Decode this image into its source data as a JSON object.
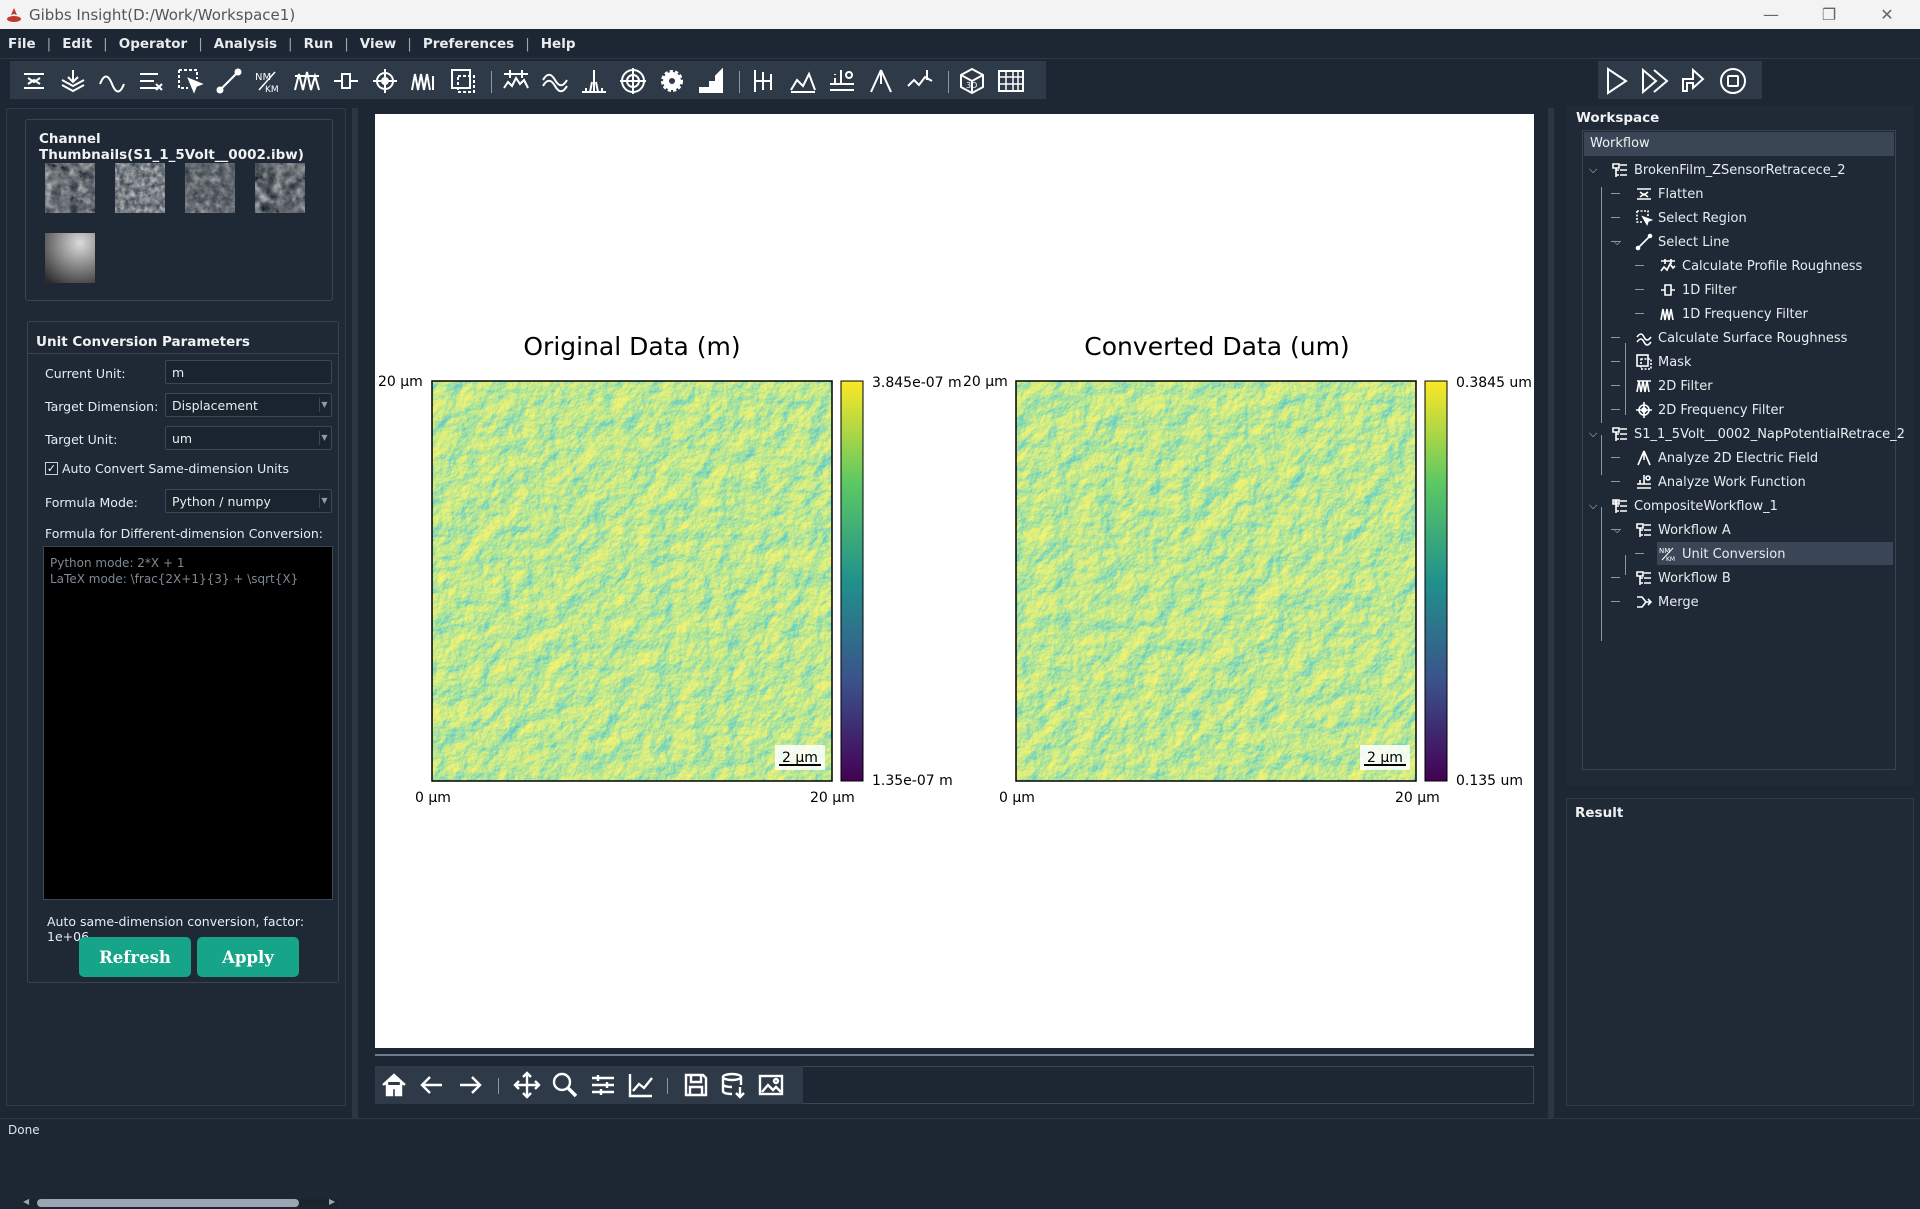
{
  "window": {
    "title": "Gibbs Insight(D:/Work/Workspace1)",
    "minimize": "—",
    "restore": "❐",
    "close": "✕"
  },
  "menu": [
    "File",
    "Edit",
    "Operator",
    "Analysis",
    "Run",
    "View",
    "Preferences",
    "Help"
  ],
  "menu_separator": "|",
  "left_panel": {
    "thumbnails_title": "Channel Thumbnails(S1_1_5Volt__0002.ibw)",
    "conversion": {
      "title": "Unit Conversion Parameters",
      "current_unit_label": "Current Unit:",
      "current_unit_value": "m",
      "target_dimension_label": "Target Dimension:",
      "target_dimension_value": "Displacement",
      "target_unit_label": "Target Unit:",
      "target_unit_value": "um",
      "auto_convert_label": "Auto Convert Same-dimension Units",
      "auto_convert_checked": true,
      "formula_mode_label": "Formula Mode:",
      "formula_mode_value": "Python / numpy",
      "formula_label": "Formula for Different-dimension Conversion:",
      "formula_placeholder": "Python mode: 2*X + 1\nLaTeX mode: \\frac{2X+1}{3} + \\sqrt{X}",
      "factor_text": "Auto same-dimension conversion, factor: 1e+06",
      "refresh_label": "Refresh",
      "apply_label": "Apply"
    }
  },
  "plots": [
    {
      "title": "Original Data (m)",
      "y_top": "20 µm",
      "x_left": "0 µm",
      "x_right": "20 µm",
      "scalebar": "2 µm",
      "cbar_max": "3.845e-07 m",
      "cbar_min": "1.35e-07 m"
    },
    {
      "title": "Converted Data (um)",
      "y_top": "20 µm",
      "x_left": "0 µm",
      "x_right": "20 µm",
      "scalebar": "2 µm",
      "cbar_max": "0.3845 um",
      "cbar_min": "0.135 um"
    }
  ],
  "workspace": {
    "title": "Workspace",
    "header": "Workflow",
    "tree": [
      {
        "label": "BrokenFilm_ZSensorRetracece_2",
        "level": 0,
        "expanded": true,
        "icon": "workflow-icon"
      },
      {
        "label": "Flatten",
        "level": 1,
        "icon": "flatten-icon"
      },
      {
        "label": "Select Region",
        "level": 1,
        "icon": "select-region-icon"
      },
      {
        "label": "Select Line",
        "level": 1,
        "expanded": true,
        "icon": "select-line-icon"
      },
      {
        "label": "Calculate Profile Roughness",
        "level": 2,
        "icon": "profile-roughness-icon"
      },
      {
        "label": "1D Filter",
        "level": 2,
        "icon": "filter-1d-icon"
      },
      {
        "label": "1D Frequency Filter",
        "level": 2,
        "icon": "frequency-filter-1d-icon"
      },
      {
        "label": "Calculate Surface Roughness",
        "level": 1,
        "icon": "surface-roughness-icon"
      },
      {
        "label": "Mask",
        "level": 1,
        "icon": "mask-icon"
      },
      {
        "label": "2D Filter",
        "level": 1,
        "icon": "filter-2d-icon"
      },
      {
        "label": "2D Frequency Filter",
        "level": 1,
        "icon": "frequency-filter-2d-icon"
      },
      {
        "label": "S1_1_5Volt__0002_NapPotentialRetrace_2",
        "level": 0,
        "expanded": true,
        "icon": "workflow-icon"
      },
      {
        "label": "Analyze 2D Electric Field",
        "level": 1,
        "icon": "electric-field-icon"
      },
      {
        "label": "Analyze Work Function",
        "level": 1,
        "icon": "work-function-icon"
      },
      {
        "label": "CompositeWorkflow_1",
        "level": 0,
        "expanded": true,
        "icon": "composite-workflow-icon"
      },
      {
        "label": "Workflow A",
        "level": 1,
        "expanded": true,
        "icon": "workflow-icon"
      },
      {
        "label": "Unit Conversion",
        "level": 2,
        "selected": true,
        "icon": "unit-conversion-icon"
      },
      {
        "label": "Workflow B",
        "level": 1,
        "icon": "workflow-icon"
      },
      {
        "label": "Merge",
        "level": 1,
        "icon": "merge-icon"
      }
    ]
  },
  "result": {
    "title": "Result"
  },
  "status": "Done",
  "colors": {
    "accent": "#17a589",
    "background": "#1d2733",
    "toolbar": "#2e3a48",
    "selected_row": "#3a4655"
  }
}
